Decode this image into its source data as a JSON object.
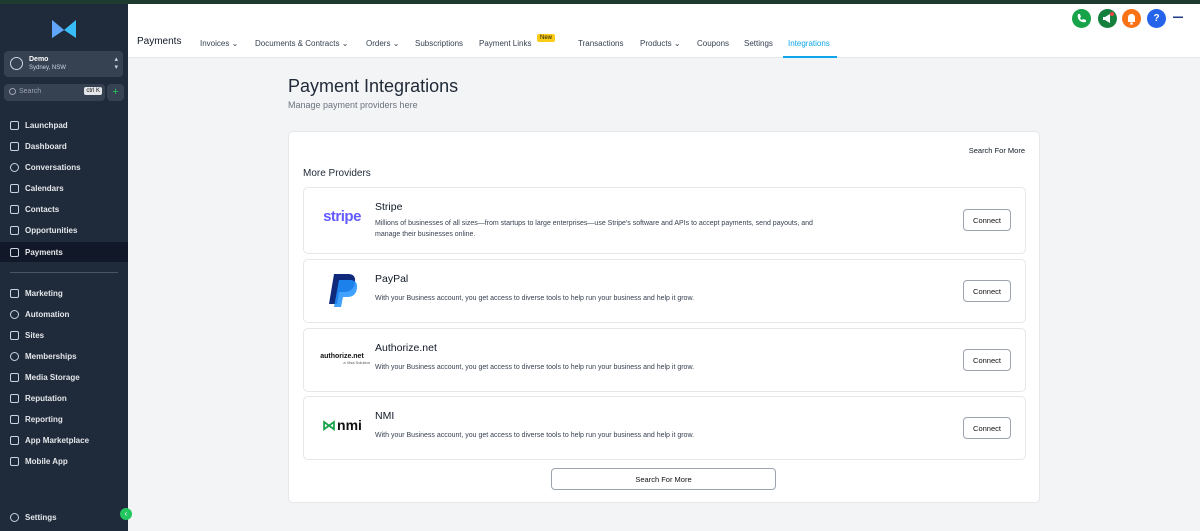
{
  "sidebar": {
    "location": {
      "name": "Demo",
      "sub": "Sydney, NSW"
    },
    "search": {
      "placeholder": "Search",
      "shortcut": "ctrl K",
      "add": "+"
    },
    "items": [
      {
        "label": "Launchpad",
        "icon": "rocket-icon"
      },
      {
        "label": "Dashboard",
        "icon": "grid-icon"
      },
      {
        "label": "Conversations",
        "icon": "chat-icon"
      },
      {
        "label": "Calendars",
        "icon": "calendar-icon"
      },
      {
        "label": "Contacts",
        "icon": "contacts-icon"
      },
      {
        "label": "Opportunities",
        "icon": "funnel-icon"
      },
      {
        "label": "Payments",
        "icon": "payments-icon",
        "active": true
      }
    ],
    "items2": [
      {
        "label": "Marketing",
        "icon": "send-icon"
      },
      {
        "label": "Automation",
        "icon": "automation-icon"
      },
      {
        "label": "Sites",
        "icon": "sites-icon"
      },
      {
        "label": "Memberships",
        "icon": "membership-icon"
      },
      {
        "label": "Media Storage",
        "icon": "media-icon"
      },
      {
        "label": "Reputation",
        "icon": "star-icon"
      },
      {
        "label": "Reporting",
        "icon": "chart-icon"
      },
      {
        "label": "App Marketplace",
        "icon": "apps-icon"
      },
      {
        "label": "Mobile App",
        "icon": "phone-icon"
      }
    ],
    "settings": "Settings"
  },
  "topbar": {
    "title": "Payments",
    "tabs": [
      "Invoices",
      "Documents & Contracts",
      "Orders",
      "Subscriptions",
      "Payment Links",
      "Transactions",
      "Products",
      "Coupons",
      "Settings",
      "Integrations"
    ],
    "new_badge": "New",
    "active_tab": "Integrations",
    "help": "?"
  },
  "main": {
    "title": "Payment Integrations",
    "subtitle": "Manage payment providers here",
    "search_for_more": "Search For More",
    "section_title": "More Providers",
    "providers": [
      {
        "name": "Stripe",
        "logo": "stripe",
        "desc": "Millions of businesses of all sizes—from startups to large enterprises—use Stripe's software and APIs to accept payments, send payouts, and manage their businesses online.",
        "button": "Connect"
      },
      {
        "name": "PayPal",
        "logo": "P",
        "desc": "With your Business account, you get access to diverse tools to help run your business and help it grow.",
        "button": "Connect"
      },
      {
        "name": "Authorize.net",
        "logo": "authorize.net",
        "logo_sub": "a Visa Solution",
        "desc": "With your Business account, you get access to diverse tools to help run your business and help it grow.",
        "button": "Connect"
      },
      {
        "name": "NMI",
        "logo": "nmi",
        "desc": "With your Business account, you get access to diverse tools to help run your business and help it grow.",
        "button": "Connect"
      }
    ],
    "bottom_button": "Search For More"
  },
  "colors": {
    "accent": "#0ea5e9",
    "sidebar": "#1f2a3a",
    "stripe": "#635bff",
    "new_badge": "#facc15"
  }
}
